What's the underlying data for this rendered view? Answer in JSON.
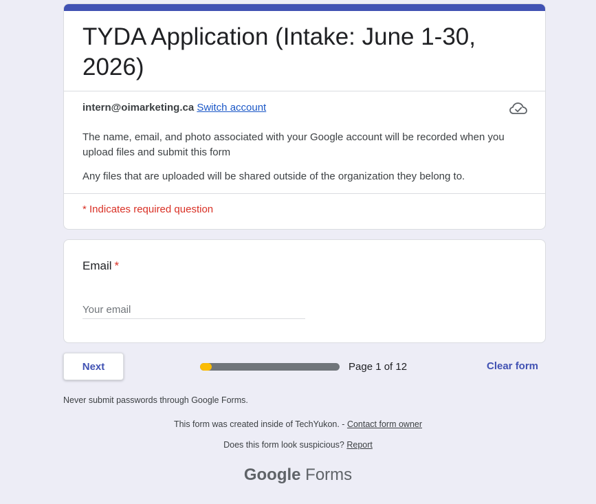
{
  "form": {
    "title": "TYDA Application (Intake: June 1-30, 2026)",
    "accent_color": "#4152b3"
  },
  "account": {
    "email": "intern@oimarketing.ca",
    "switch_label": "Switch account",
    "cloud_icon": "cloud-check-icon"
  },
  "notices": {
    "recorded": "The name, email, and photo associated with your Google account will be recorded when you upload files and submit this form",
    "shared": "Any files that are uploaded will be shared outside of the organization they belong to."
  },
  "required_note": "* Indicates required question",
  "question": {
    "label": "Email",
    "required_marker": "*",
    "placeholder": "Your email",
    "value": ""
  },
  "navigation": {
    "next_label": "Next",
    "page_text": "Page 1 of 12",
    "progress_fraction": 0.0833,
    "progress_color": "#fbbc04",
    "clear_label": "Clear form"
  },
  "footer": {
    "password_warning": "Never submit passwords through Google Forms.",
    "created_text": "This form was created inside of TechYukon. - ",
    "contact_label": "Contact form owner",
    "suspicious_text": "Does this form look suspicious? ",
    "report_label": "Report",
    "logo_word1": "Google",
    "logo_word2": " Forms"
  }
}
